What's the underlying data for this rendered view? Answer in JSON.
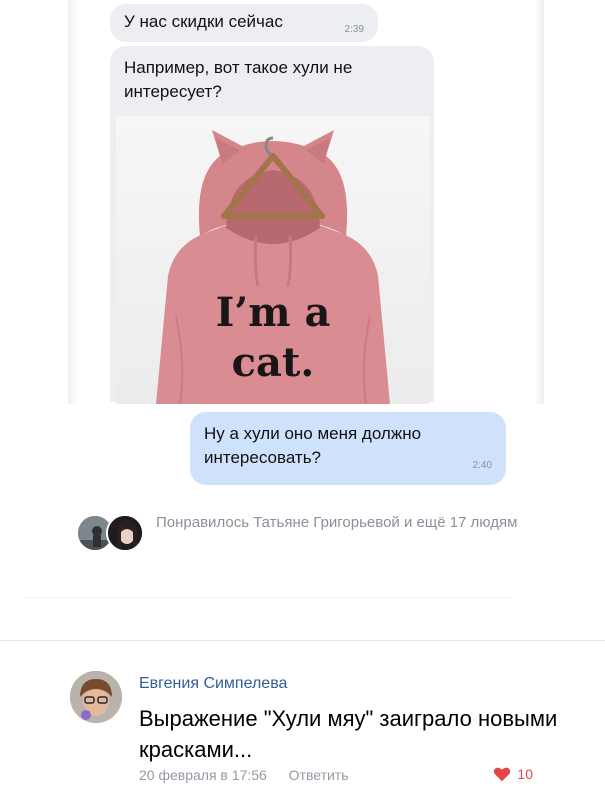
{
  "chat": {
    "messages": [
      {
        "text": "У нас скидки сейчас",
        "time": "2:39"
      },
      {
        "text": "Например, вот такое хули не интересует?"
      }
    ],
    "photo": {
      "print_line1": "I’m a",
      "print_line2": "cat."
    },
    "reply": {
      "text": "Ну а хули оно меня должно интересовать?",
      "time": "2:40"
    }
  },
  "post_likes": {
    "text": "Понравилось Татьяне Григорьевой и ещё 17 людям"
  },
  "comment": {
    "author": "Евгения Симпелева",
    "text": "Выражение \"Хули мяу\" заиграло новыми красками...",
    "date": "20 февраля в 17:56",
    "reply_label": "Ответить",
    "likes": "10",
    "colors": {
      "author": "#2f5f99",
      "like": "#e6454a",
      "meta": "#939aa3"
    }
  }
}
